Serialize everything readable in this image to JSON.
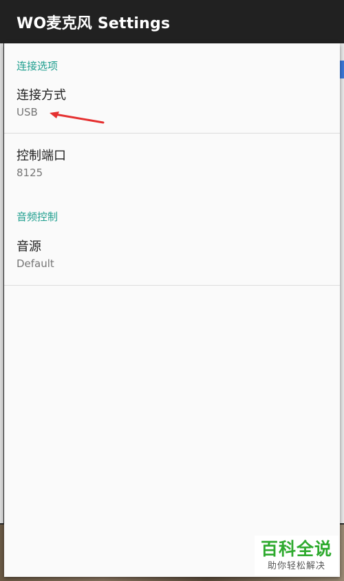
{
  "app_bar": {
    "title": "WO麦克风 Settings"
  },
  "settings": {
    "category_connection": "连接选项",
    "connection_method": {
      "title": "连接方式",
      "summary": "USB"
    },
    "control_port": {
      "title": "控制端口",
      "summary": "8125"
    },
    "category_audio": "音频控制",
    "audio_source": {
      "title": "音源",
      "summary": "Default"
    }
  },
  "watermark": {
    "main": "百科全说",
    "sub": "助你轻松解决"
  },
  "colors": {
    "accent": "#1e9e8e",
    "app_bar": "#212121",
    "annotation": "#e53030",
    "watermark_green": "#2eaa2e"
  }
}
